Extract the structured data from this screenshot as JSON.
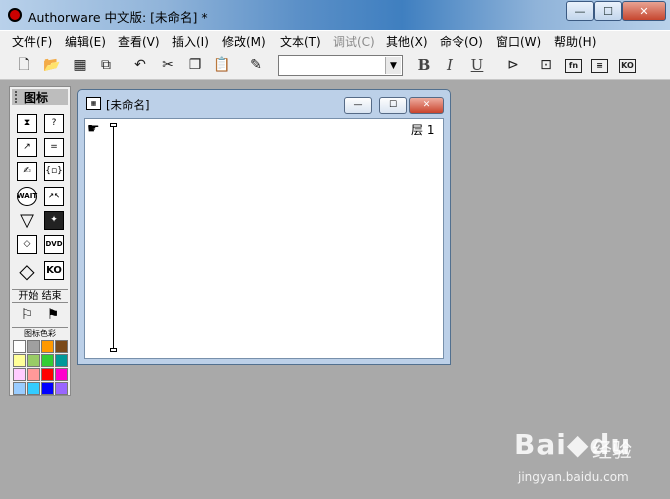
{
  "window": {
    "title": "Authorware 中文版: [未命名] *",
    "controls": {
      "minimize": "—",
      "maximize": "☐",
      "close": "✕"
    }
  },
  "menu": [
    {
      "label": "文件(F)",
      "enabled": true
    },
    {
      "label": "编辑(E)",
      "enabled": true
    },
    {
      "label": "查看(V)",
      "enabled": true
    },
    {
      "label": "插入(I)",
      "enabled": true
    },
    {
      "label": "修改(M)",
      "enabled": true
    },
    {
      "label": "文本(T)",
      "enabled": true
    },
    {
      "label": "调试(C)",
      "enabled": false
    },
    {
      "label": "其他(X)",
      "enabled": true
    },
    {
      "label": "命令(O)",
      "enabled": true
    },
    {
      "label": "窗口(W)",
      "enabled": true
    },
    {
      "label": "帮助(H)",
      "enabled": true
    }
  ],
  "toolbar": {
    "font_select_value": "",
    "format": {
      "bold": "B",
      "italic": "I",
      "underline": "U"
    },
    "glyphs": {
      "new": "🗋",
      "open": "📂",
      "save": "▦",
      "import": "⧉",
      "undo": "↶",
      "cut": "✂",
      "copy": "❐",
      "paste": "📋",
      "find": "✎",
      "run": "⊳",
      "control_panel": "⊡"
    },
    "boxed_labels": {
      "functions": "fn",
      "variables": "≡",
      "knowledge_objects": "KO"
    }
  },
  "palette": {
    "title": "图标",
    "icons": {
      "display": "⧗",
      "interaction": "?",
      "motion": "↗",
      "calculation": "=",
      "erase": "✍",
      "map": "{▫}",
      "wait": "WAIT",
      "navigate": "↗↖",
      "decision": "▽",
      "framework": "✦",
      "sound": "◇",
      "digital_movie": "DVD",
      "video": "◇",
      "knowledge_object": "KO"
    },
    "start_end_label": "开始  结束",
    "start_flag": "⚐",
    "end_flag": "⚑",
    "color_label": "图标色彩",
    "colors": [
      "#ffffff",
      "#a0a0a0",
      "#ff9900",
      "#7a4a1a",
      "#ffff99",
      "#99cc66",
      "#33cc33",
      "#009999",
      "#ffccff",
      "#ff9999",
      "#ff0000",
      "#ff00cc",
      "#99ccff",
      "#33ccff",
      "#0000ff",
      "#9966ff"
    ]
  },
  "design_window": {
    "title": "[未命名]",
    "icon_label": "▦",
    "layer_label": "层 1",
    "hand_glyph": "☛",
    "controls": {
      "minimize": "—",
      "maximize": "☐",
      "close": "✕"
    }
  },
  "watermark": {
    "logo": "Bai",
    "paw": "◆",
    "suffix": "du",
    "text": "经验",
    "url": "jingyan.baidu.com"
  }
}
